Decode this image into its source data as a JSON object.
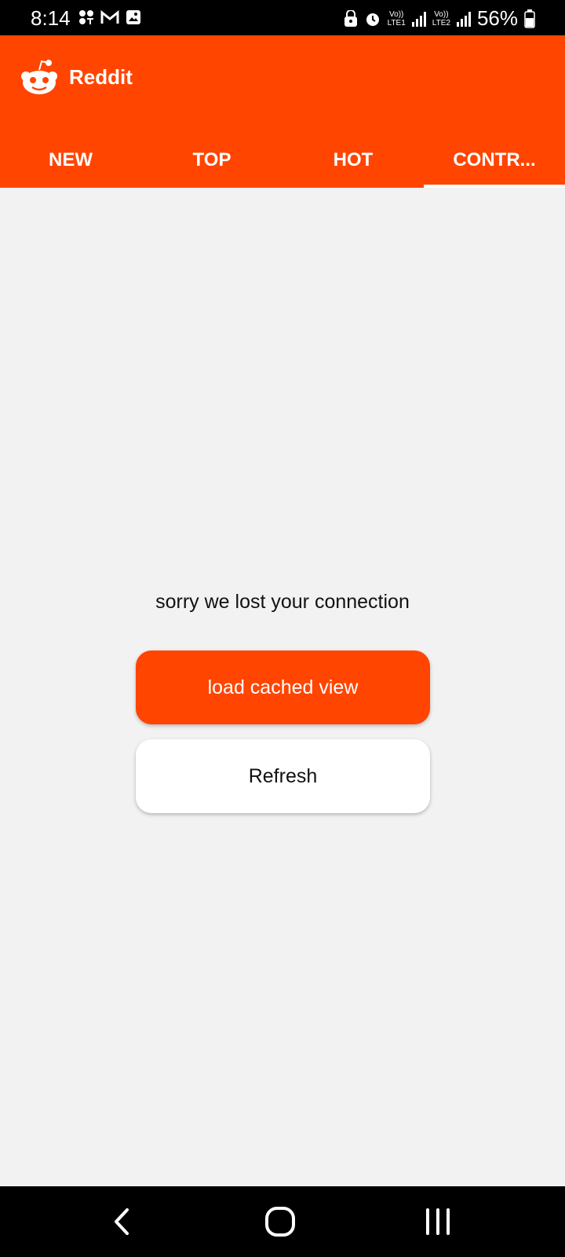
{
  "status_bar": {
    "time": "8:14",
    "net1_top": "Vo))",
    "net1_bottom": "LTE1",
    "net2_top": "Vo))",
    "net2_bottom": "LTE2",
    "battery": "56%"
  },
  "app": {
    "title": "Reddit",
    "brand_color": "#ff4500"
  },
  "tabs": [
    {
      "label": "NEW",
      "selected": false
    },
    {
      "label": "TOP",
      "selected": false
    },
    {
      "label": "HOT",
      "selected": false
    },
    {
      "label": "CONTR...",
      "selected": true
    }
  ],
  "content": {
    "message": "sorry we lost your connection",
    "primary_button": "load cached view",
    "secondary_button": "Refresh"
  }
}
